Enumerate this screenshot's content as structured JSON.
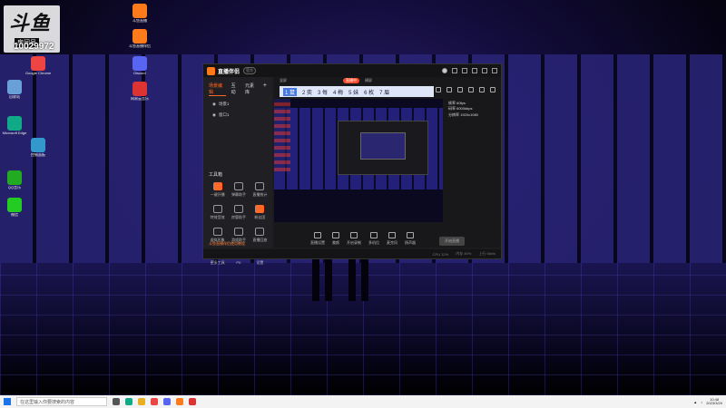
{
  "desktop": {
    "room_label": "房间号",
    "room_number": "10029972",
    "logo_text": "斗鱼",
    "icons": [
      {
        "label": "回收站",
        "color": "#6aa0d8"
      },
      {
        "label": "Google Chrome",
        "color": "#e44"
      },
      {
        "label": "斗鱼直播",
        "color": "#ff7a1a"
      },
      {
        "label": "斗鱼直播伴侣",
        "color": "#ff7a1a"
      },
      {
        "label": "Discord",
        "color": "#5865f2"
      },
      {
        "label": "网易云音乐",
        "color": "#d33"
      },
      {
        "label": "Microsoft Edge",
        "color": "#1a8"
      },
      {
        "label": "QQ音乐",
        "color": "#2a2"
      },
      {
        "label": "微信",
        "color": "#2c2"
      },
      {
        "label": "控制面板",
        "color": "#39c"
      }
    ]
  },
  "app": {
    "title": "直播伴侣",
    "version": "官方",
    "left_tabs": [
      "场景编辑",
      "互动",
      "元素库"
    ],
    "scenes": [
      "场景1",
      "窗口1"
    ],
    "tools_title": "工具箱",
    "tools": [
      "一键开播",
      "弹幕助手",
      "直播统计",
      "特效音效",
      "房管助手",
      "粉丝团",
      "虚拟形象",
      "游戏助手",
      "直播回放",
      "更多工具",
      "PK",
      "设置"
    ],
    "tip": "斗鱼直播伴侣使用教程",
    "main_tabs": [
      "竖屏",
      "直播中",
      "横屏"
    ],
    "ime": [
      "1 鼠",
      "2 奕",
      "3 每",
      "4 梅",
      "5 妹",
      "6 枚",
      "7 眉"
    ],
    "info_lines": [
      "帧率 60fps",
      "码率 6000kbps",
      "分辨率 1920x1080"
    ],
    "bottom_tools": [
      "直播设置",
      "美颜",
      "开启录制",
      "多机位",
      "麦克风",
      "扬声器"
    ],
    "start_button": "开始直播",
    "status": [
      "CPU 12%",
      "内存 40%",
      "上行 0kb/s"
    ]
  },
  "taskbar": {
    "search_placeholder": "在这里输入你要搜索的内容",
    "time": "10:48",
    "date": "2023/3/20"
  }
}
